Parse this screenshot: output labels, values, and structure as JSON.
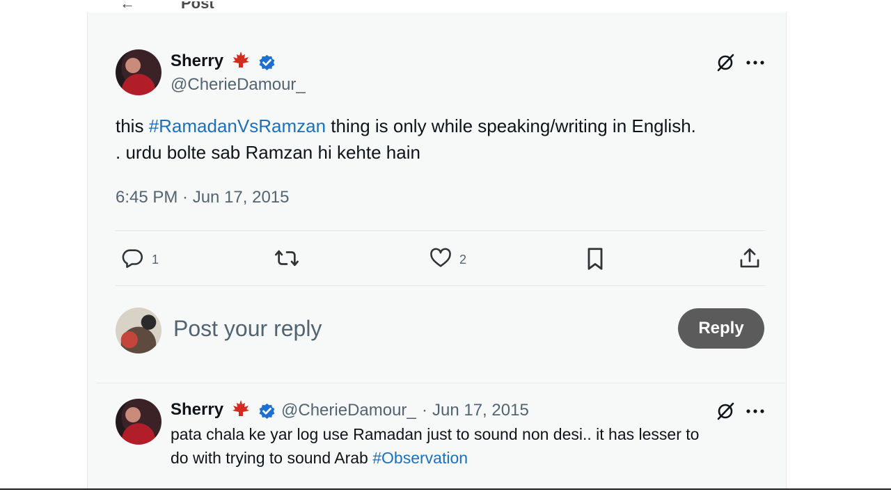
{
  "top_fragment": "Post",
  "main_post": {
    "author_name": "Sherry",
    "author_handle": "@CherieDamour_",
    "flag_icon": "canada-flag-icon",
    "text_before_tag": "this ",
    "hashtag": "#RamadanVsRamzan",
    "text_after_tag": " thing is only while speaking/writing in English.",
    "text_line2": ". urdu bolte sab Ramzan hi kehte hain",
    "timestamp": "6:45 PM · Jun 17, 2015",
    "reply_count": "1",
    "like_count": "2"
  },
  "reply_box": {
    "placeholder": "Post your reply",
    "button_label": "Reply"
  },
  "reply_post": {
    "author_name": "Sherry",
    "author_handle": "@CherieDamour_",
    "separator": "·",
    "date": "Jun 17, 2015",
    "text_line1": "pata chala ke yar log use Ramadan just to sound non desi.. it has lesser to",
    "text_line2_before_tag": "do with trying to sound Arab ",
    "hashtag": "#Observation"
  },
  "colors": {
    "hashtag": "#1d70b8",
    "verified": "#1d6fd1",
    "reply_button": "#5b5b5b",
    "flag": "#d52b1e"
  }
}
